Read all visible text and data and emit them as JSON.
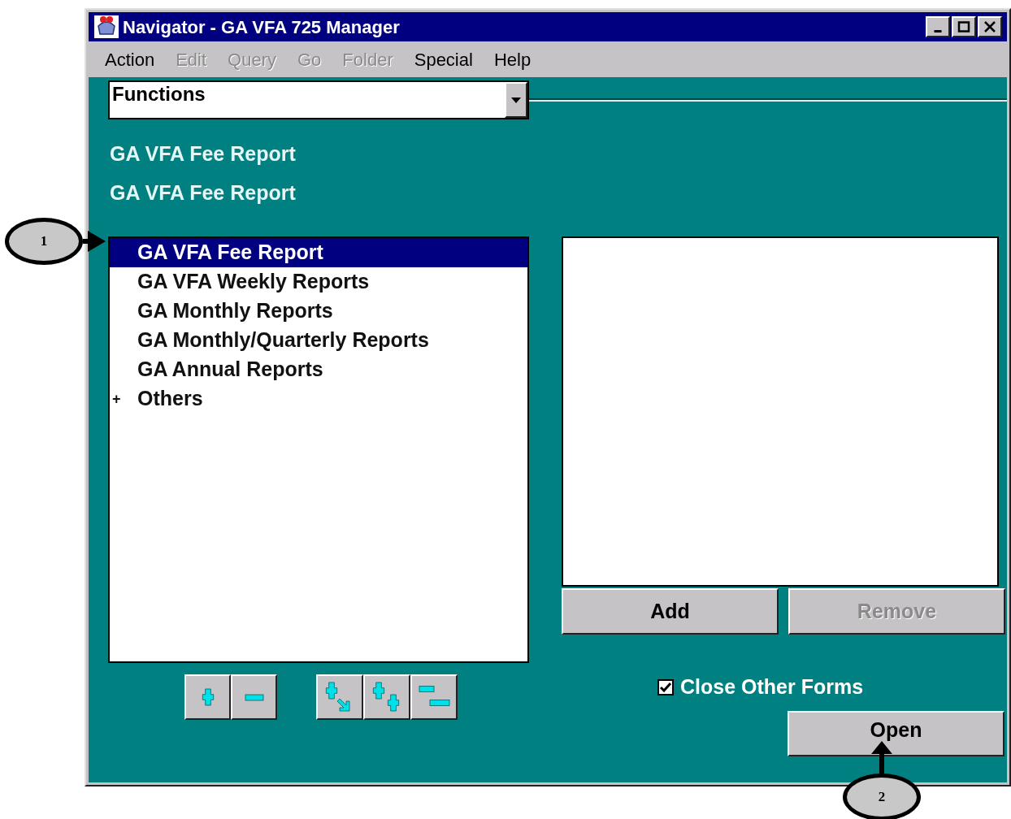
{
  "window": {
    "title": "Navigator - GA VFA 725 Manager"
  },
  "menu": [
    {
      "label": "Action",
      "disabled": false
    },
    {
      "label": "Edit",
      "disabled": true
    },
    {
      "label": "Query",
      "disabled": true
    },
    {
      "label": "Go",
      "disabled": true
    },
    {
      "label": "Folder",
      "disabled": true
    },
    {
      "label": "Special",
      "disabled": false
    },
    {
      "label": "Help",
      "disabled": false
    }
  ],
  "functions_dropdown": {
    "value": "Functions"
  },
  "headings": [
    "GA VFA Fee Report",
    "GA VFA Fee Report"
  ],
  "tree": [
    {
      "label": "GA VFA Fee Report",
      "selected": true
    },
    {
      "label": "GA VFA Weekly Reports",
      "selected": false
    },
    {
      "label": "GA Monthly Reports",
      "selected": false
    },
    {
      "label": "GA Monthly/Quarterly Reports",
      "selected": false
    },
    {
      "label": "GA Annual Reports",
      "selected": false
    },
    {
      "label": "Others",
      "selected": false,
      "marker": "+"
    }
  ],
  "tree_buttons": [
    {
      "kind": "expand"
    },
    {
      "kind": "collapse"
    },
    {
      "kind": "expand-branch"
    },
    {
      "kind": "expand-all"
    },
    {
      "kind": "collapse-all"
    }
  ],
  "add_button": {
    "label": "Add",
    "disabled": false
  },
  "remove_button": {
    "label": "Remove",
    "disabled": true
  },
  "close_other_forms": {
    "label": "Close Other Forms",
    "checked": true
  },
  "open_button": {
    "label": "Open"
  },
  "callouts": [
    {
      "label": "1"
    },
    {
      "label": "2"
    }
  ]
}
